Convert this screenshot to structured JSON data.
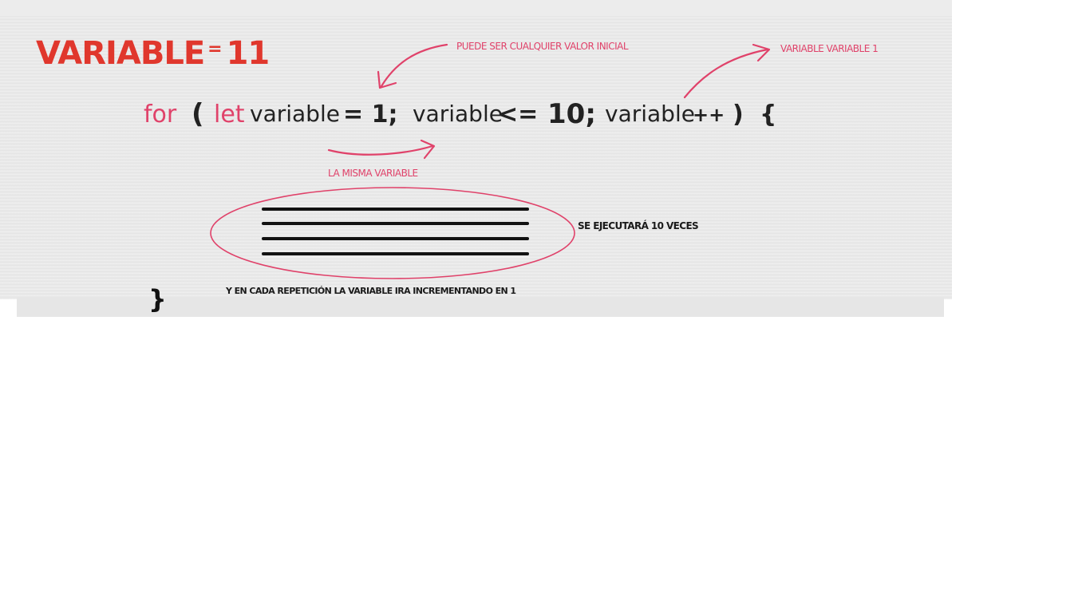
{
  "title": {
    "word": "VARIABLE",
    "sign": "=",
    "value": "11"
  },
  "code": {
    "for_kw": "for",
    "open_paren": "(",
    "let_kw": "let",
    "var1": "variable",
    "assign": "= 1;",
    "var2": "variable",
    "compare": "<=",
    "limit": "10;",
    "var3": "variable",
    "increment": "++",
    "close_paren": ")",
    "open_brace": "{",
    "close_brace": "}"
  },
  "notes": {
    "initial_value": "PUEDE SER CUALQUIER VALOR INICIAL",
    "increment_note": "VARIABLE  VARIABLE  1",
    "same_variable": "LA MISMA VARIABLE",
    "runs_ten_times": "SE EJECUTARÁ 10 VECES",
    "each_repetition": "Y EN CADA REPETICIÓN LA VARIABLE IRA INCREMENTANDO EN 1"
  },
  "colors": {
    "title_red": "#e0372d",
    "annotation_pink": "#e0426a",
    "ink": "#111111",
    "board_gray": "#e9e9e9"
  }
}
